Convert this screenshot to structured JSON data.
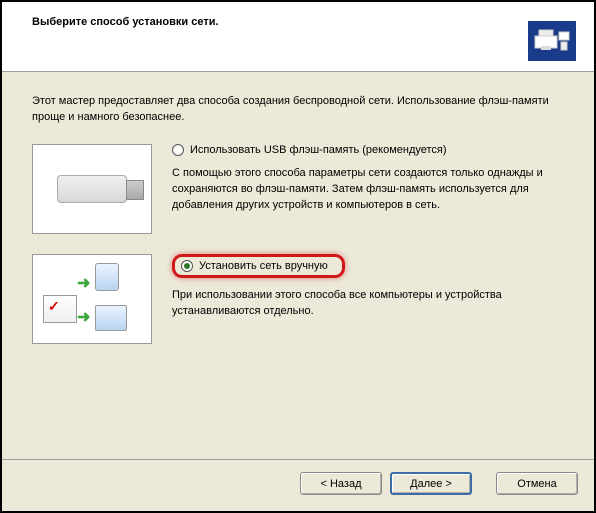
{
  "header": {
    "title": "Выберите способ установки сети."
  },
  "intro": "Этот мастер предоставляет два способа создания беспроводной сети. Использование флэш-памяти проще и намного безопаснее.",
  "options": {
    "usb": {
      "label": "Использовать USB флэш-память (рекомендуется)",
      "desc": "С помощью этого способа параметры сети создаются только однажды и сохраняются во флэш-памяти. Затем флэш-память используется для добавления других устройств и компьютеров в сеть.",
      "selected": false
    },
    "manual": {
      "label": "Установить сеть вручную",
      "desc": "При использовании этого способа все компьютеры и устройства устанавливаются отдельно.",
      "selected": true
    }
  },
  "buttons": {
    "back": "< Назад",
    "next": "Далее >",
    "cancel": "Отмена"
  }
}
